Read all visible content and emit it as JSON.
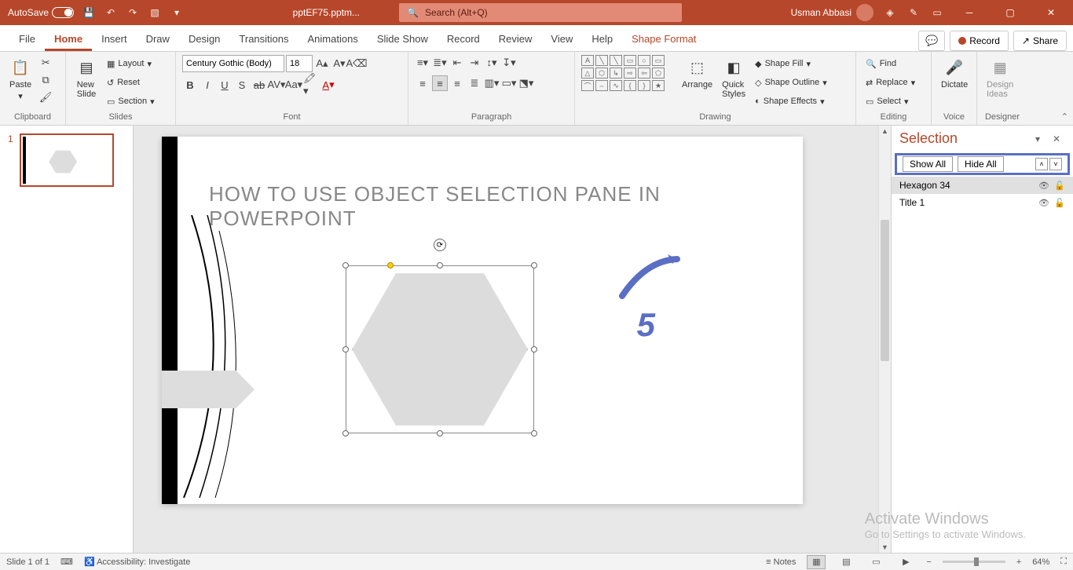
{
  "titlebar": {
    "autosave_label": "AutoSave",
    "autosave_state": "Off",
    "filename": "pptEF75.pptm...",
    "search_placeholder": "Search (Alt+Q)",
    "user_name": "Usman Abbasi"
  },
  "tabs": {
    "file": "File",
    "home": "Home",
    "insert": "Insert",
    "draw": "Draw",
    "design": "Design",
    "transitions": "Transitions",
    "animations": "Animations",
    "slideshow": "Slide Show",
    "record": "Record",
    "review": "Review",
    "view": "View",
    "help": "Help",
    "shape_format": "Shape Format",
    "record_btn": "Record",
    "share_btn": "Share"
  },
  "ribbon": {
    "clipboard": {
      "paste": "Paste",
      "label": "Clipboard"
    },
    "slides": {
      "new_slide": "New\nSlide",
      "layout": "Layout",
      "reset": "Reset",
      "section": "Section",
      "label": "Slides"
    },
    "font": {
      "name": "Century Gothic (Body)",
      "size": "18",
      "label": "Font"
    },
    "paragraph": {
      "label": "Paragraph"
    },
    "drawing": {
      "arrange": "Arrange",
      "quick_styles": "Quick\nStyles",
      "shape_fill": "Shape Fill",
      "shape_outline": "Shape Outline",
      "shape_effects": "Shape Effects",
      "label": "Drawing"
    },
    "editing": {
      "find": "Find",
      "replace": "Replace",
      "select": "Select",
      "label": "Editing"
    },
    "voice": {
      "dictate": "Dictate",
      "label": "Voice"
    },
    "designer": {
      "design_ideas": "Design\nIdeas",
      "label": "Designer"
    }
  },
  "thumbs": {
    "n1": "1"
  },
  "slide": {
    "title": "HOW TO USE OBJECT  SELECTION PANE  IN POWERPOINT"
  },
  "annotation": {
    "num": "5"
  },
  "selection_pane": {
    "title": "Selection",
    "show_all": "Show All",
    "hide_all": "Hide All",
    "items": [
      {
        "name": "Hexagon 34",
        "selected": true
      },
      {
        "name": "Title 1",
        "selected": false
      }
    ]
  },
  "status": {
    "slide_info": "Slide 1 of 1",
    "accessibility": "Accessibility: Investigate",
    "notes": "Notes",
    "zoom": "64%"
  },
  "watermark": {
    "line1": "Activate Windows",
    "line2": "Go to Settings to activate Windows."
  }
}
